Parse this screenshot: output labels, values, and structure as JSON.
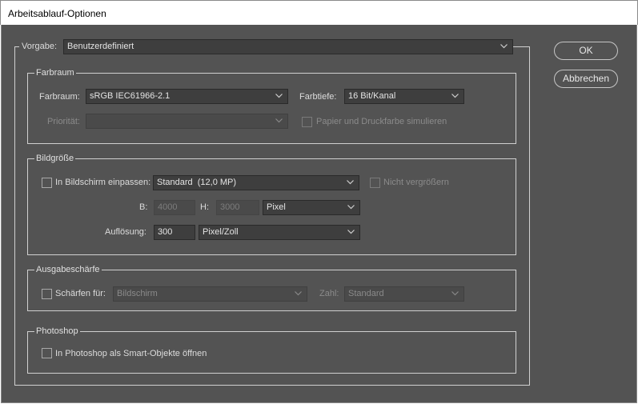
{
  "window": {
    "title": "Arbeitsablauf-Optionen"
  },
  "preset": {
    "label": "Vorgabe:",
    "value": "Benutzerdefiniert"
  },
  "color_space": {
    "group_title": "Farbraum",
    "space_label": "Farbraum:",
    "space_value": "sRGB IEC61966-2.1",
    "depth_label": "Farbtiefe:",
    "depth_value": "16 Bit/Kanal",
    "priority_label": "Priorität:",
    "priority_value": "",
    "simulate_label": "Papier und Druckfarbe simulieren"
  },
  "image_size": {
    "group_title": "Bildgröße",
    "fit_label": "In Bildschirm einpassen:",
    "fit_value": "Standard  (12,0 MP)",
    "no_enlarge_label": "Nicht vergrößern",
    "width_label": "B:",
    "width_value": "4000",
    "height_label": "H:",
    "height_value": "3000",
    "unit_value": "Pixel",
    "resolution_label": "Auflösung:",
    "resolution_value": "300",
    "resolution_unit": "Pixel/Zoll"
  },
  "sharpening": {
    "group_title": "Ausgabeschärfe",
    "sharpen_label": "Schärfen für:",
    "sharpen_value": "Bildschirm",
    "amount_label": "Zahl:",
    "amount_value": "Standard"
  },
  "photoshop": {
    "group_title": "Photoshop",
    "smart_object_label": "In Photoshop als Smart-Objekte öffnen"
  },
  "buttons": {
    "ok": "OK",
    "cancel": "Abbrechen"
  }
}
